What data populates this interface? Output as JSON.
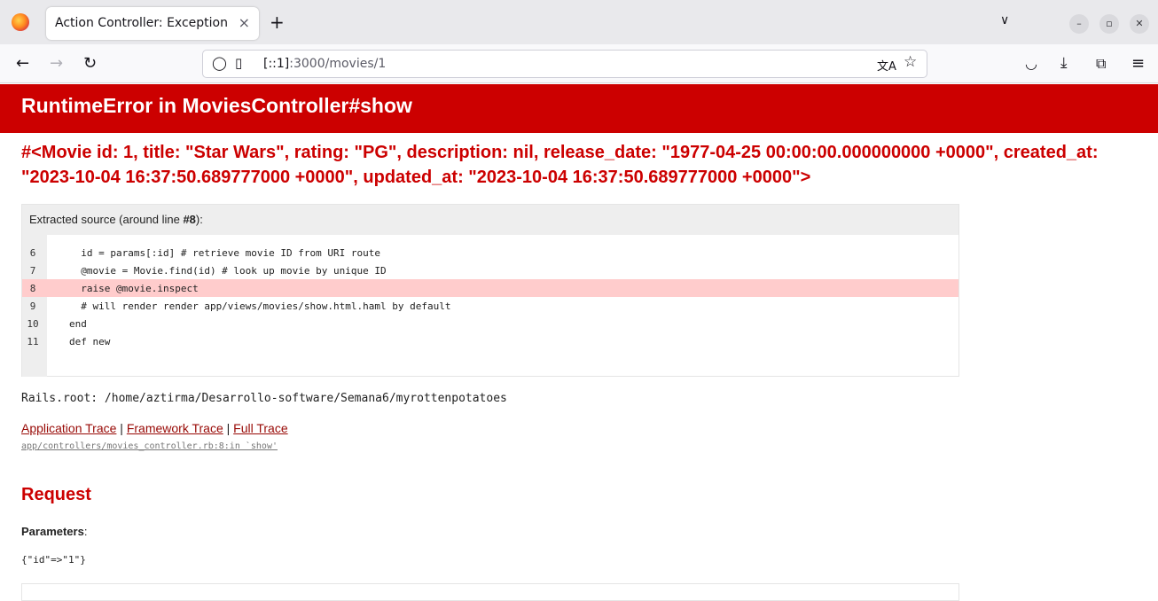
{
  "browser": {
    "tab_title": "Action Controller: Exception",
    "tab_close": "×",
    "new_tab": "+",
    "tab_list": "∨",
    "win_minimize": "–",
    "win_restore": "▫",
    "win_close": "✕",
    "url_host": "[::1]",
    "url_rest": ":3000/movies/1",
    "icons": {
      "back": "←",
      "forward": "→",
      "reload": "↻",
      "shield": "◯",
      "page": "▯",
      "translate": "文A",
      "bookmark": "☆",
      "pocket": "◡",
      "download": "⤓",
      "extensions": "⧉",
      "menu": "≡"
    }
  },
  "page": {
    "title": "RuntimeError in MoviesController#show",
    "message": "#<Movie id: 1, title: \"Star Wars\", rating: \"PG\", description: nil, release_date: \"1977-04-25 00:00:00.000000000 +0000\", created_at: \"2023-10-04 16:37:50.689777000 +0000\", updated_at: \"2023-10-04 16:37:50.689777000 +0000\">",
    "source_label_prefix": "Extracted source (around line ",
    "source_label_line": "#8",
    "source_label_suffix": "):",
    "code_lines": [
      {
        "num": "6",
        "text": "  id = params[:id] # retrieve movie ID from URI route",
        "highlight": false
      },
      {
        "num": "7",
        "text": "  @movie = Movie.find(id) # look up movie by unique ID",
        "highlight": false
      },
      {
        "num": "8",
        "text": "  raise @movie.inspect",
        "highlight": true
      },
      {
        "num": "9",
        "text": "  # will render render app/views/movies/show.html.haml by default",
        "highlight": false
      },
      {
        "num": "10",
        "text": "end",
        "highlight": false
      },
      {
        "num": "11",
        "text": "def new",
        "highlight": false
      }
    ],
    "rails_root": "Rails.root: /home/aztirma/Desarrollo-software/Semana6/myrottenpotatoes",
    "trace_links": {
      "application": "Application Trace",
      "framework": "Framework Trace",
      "full": "Full Trace",
      "separator": " | "
    },
    "trace_line": "app/controllers/movies_controller.rb:8:in `show'",
    "request_heading": "Request",
    "parameters_label": "Parameters",
    "parameters_colon": ":",
    "parameters_value": "{\"id\"=>\"1\"}"
  },
  "colors": {
    "error_red": "#cc0000",
    "highlight": "#ffcccc",
    "link": "#980905"
  }
}
